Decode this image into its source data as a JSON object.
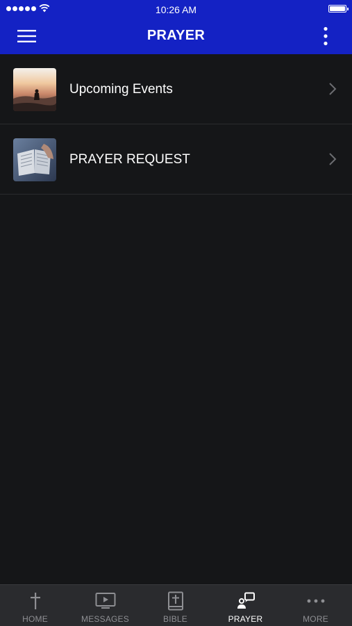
{
  "status_bar": {
    "time": "10:26 AM"
  },
  "header": {
    "title": "PRAYER"
  },
  "list": {
    "items": [
      {
        "label": "Upcoming Events"
      },
      {
        "label": "PRAYER REQUEST"
      }
    ]
  },
  "tab_bar": {
    "tabs": [
      {
        "label": "HOME",
        "icon": "cross-icon"
      },
      {
        "label": "MESSAGES",
        "icon": "video-play-icon"
      },
      {
        "label": "BIBLE",
        "icon": "bible-icon"
      },
      {
        "label": "PRAYER",
        "icon": "prayer-icon",
        "active": true
      },
      {
        "label": "MORE",
        "icon": "more-dots-icon"
      }
    ]
  },
  "colors": {
    "header_bg": "#1422c4",
    "page_bg": "#151618",
    "tabbar_bg": "#2a2b2e",
    "tab_inactive": "#8e8f93",
    "tab_active": "#ffffff"
  }
}
